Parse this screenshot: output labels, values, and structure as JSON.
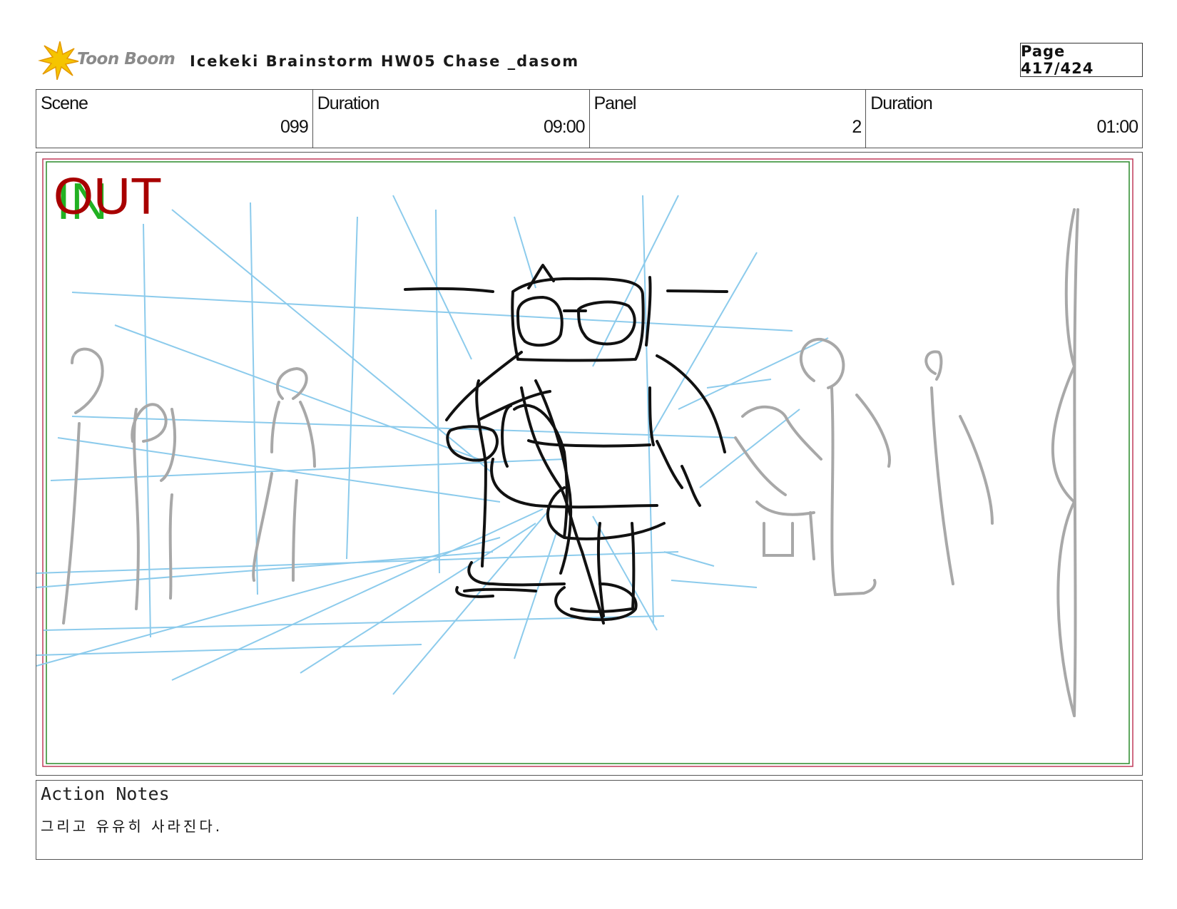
{
  "header": {
    "brand_name": "Toon Boom",
    "title": "Icekeki Brainstorm HW05 Chase _dasom",
    "page_label": "Page 417/424"
  },
  "info": {
    "scene_label": "Scene",
    "scene_value": "099",
    "scene_duration_label": "Duration",
    "scene_duration_value": "09:00",
    "panel_label": "Panel",
    "panel_value": "2",
    "panel_duration_label": "Duration",
    "panel_duration_value": "01:00"
  },
  "frame": {
    "in_label": "IN",
    "out_label": "OUT",
    "in_color": "#22b122",
    "out_color": "#a80000",
    "guide_color": "#8ccbec",
    "sketch_color": "#111111",
    "crowd_color": "#a8a8a8"
  },
  "notes": {
    "label": "Action Notes",
    "text": "그리고 유유히 사라진다."
  }
}
